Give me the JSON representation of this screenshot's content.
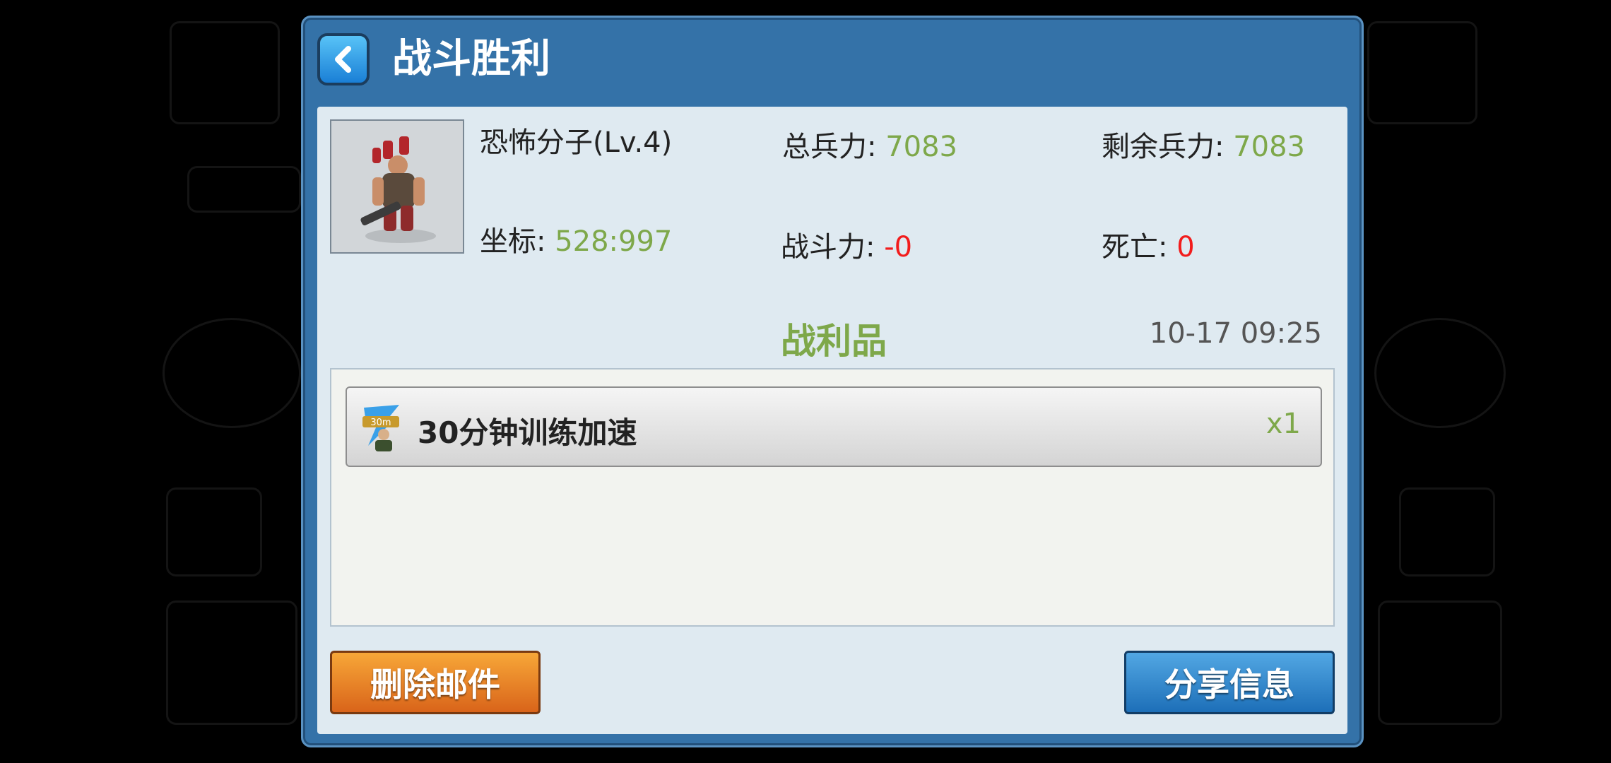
{
  "dialog": {
    "title": "战斗胜利",
    "back_icon": "chevron-left-icon"
  },
  "enemy": {
    "name": "恐怖分子(Lv.4)",
    "coord_label": "坐标:",
    "coord_value": "528:997"
  },
  "stats": {
    "total_troops_label": "总兵力:",
    "total_troops_value": "7083",
    "remaining_troops_label": "剩余兵力:",
    "remaining_troops_value": "7083",
    "power_label": "战斗力:",
    "power_value": "-0",
    "deaths_label": "死亡:",
    "deaths_value": "0"
  },
  "loot": {
    "title": "战利品",
    "timestamp": "10-17 09:25",
    "items": [
      {
        "name": "30分钟训练加速",
        "qty": "x1",
        "icon": "train-speedup-icon",
        "icon_text": "30m"
      }
    ]
  },
  "actions": {
    "delete_label": "删除邮件",
    "share_label": "分享信息"
  },
  "colors": {
    "positive": "#7ea84a",
    "negative": "#f21c1c",
    "dialog_frame": "#3472a8"
  }
}
